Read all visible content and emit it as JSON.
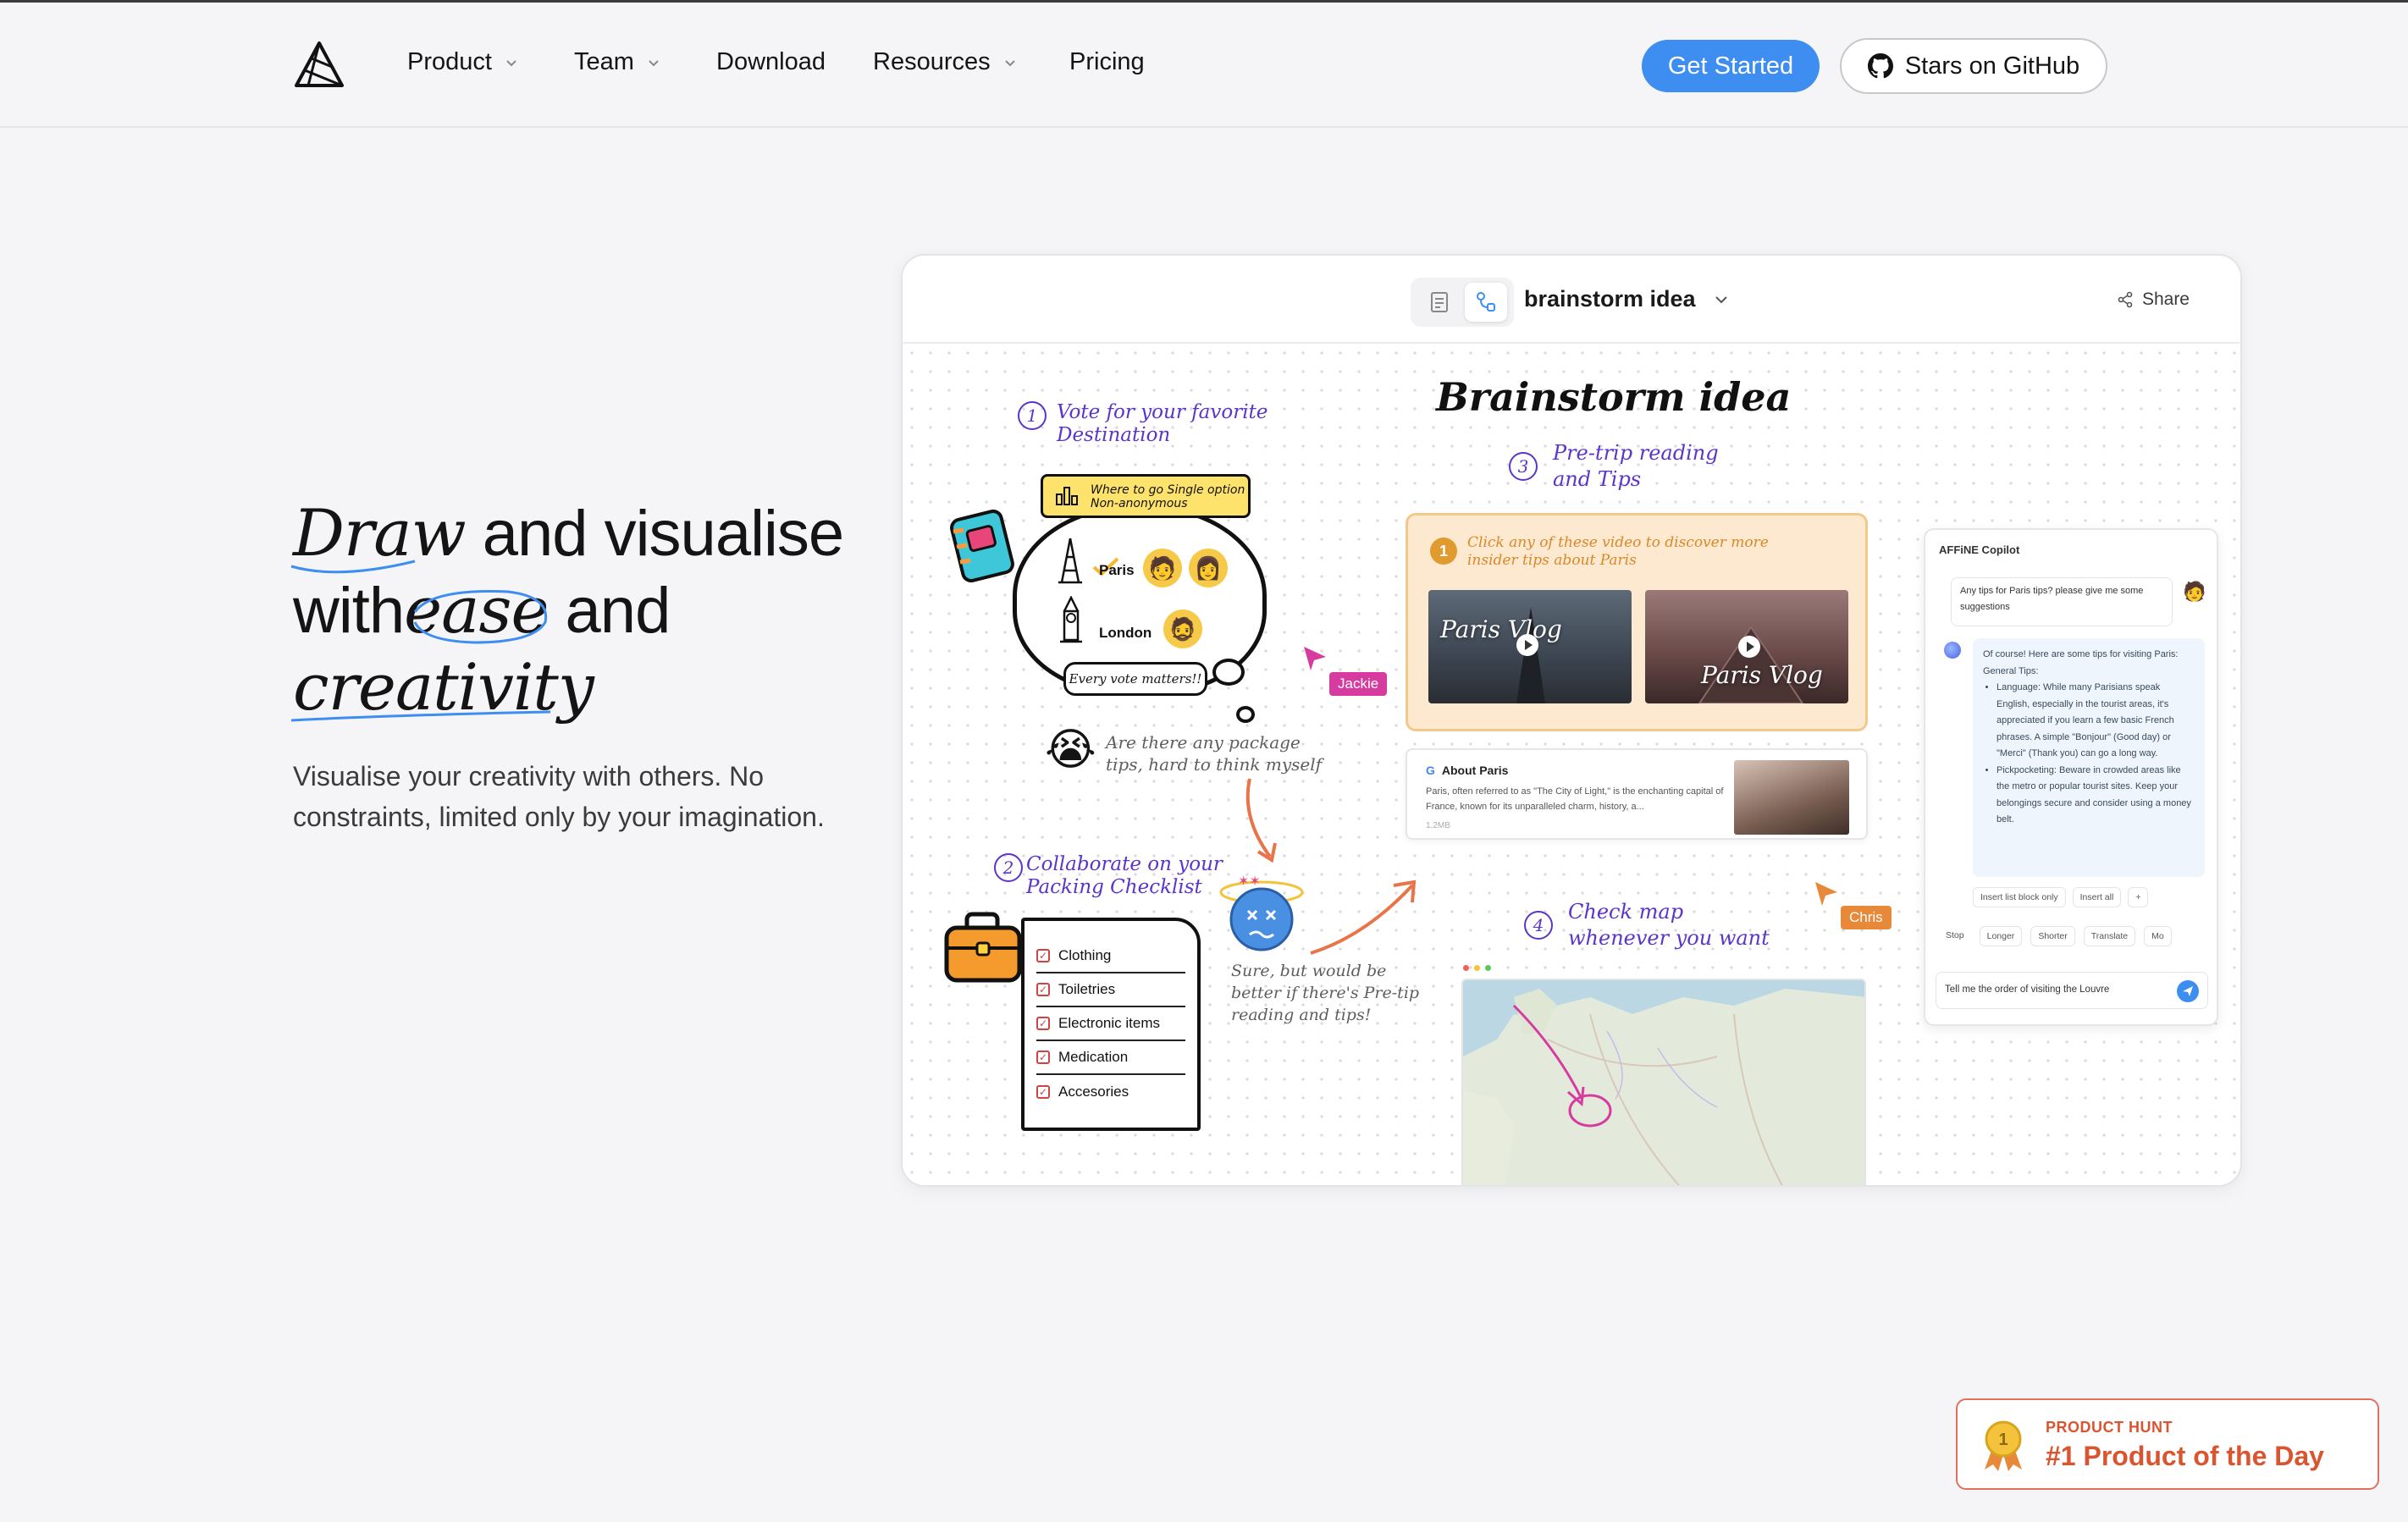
{
  "nav": {
    "items": [
      {
        "label": "Product",
        "dropdown": true
      },
      {
        "label": "Team",
        "dropdown": true
      },
      {
        "label": "Download",
        "dropdown": false
      },
      {
        "label": "Resources",
        "dropdown": true
      },
      {
        "label": "Pricing",
        "dropdown": false
      }
    ],
    "cta_label": "Get Started",
    "github_label": "Stars on GitHub"
  },
  "hero": {
    "title_word1": "Draw",
    "title_part1": " and visualise",
    "title_part2": "with",
    "title_word2": "ease",
    "title_part3": " and",
    "title_word3": "creativity",
    "subtitle": "Visualise your creativity with others. No constraints, limited only by your imagination."
  },
  "app": {
    "doc_title": "brainstorm idea",
    "share_label": "Share",
    "board_title": "Brainstorm idea",
    "step1_num": "1",
    "step1_text": "Vote for your favorite Destination",
    "vote_tag": "Where to go Single option Non-anonymous",
    "option1": "Paris",
    "option2": "London",
    "every_vote": "Every vote matters!!",
    "package_note": "Are there any package tips, hard to think myself",
    "step2_num": "2",
    "step2_text": "Collaborate on your Packing Checklist",
    "checklist": [
      "Clothing",
      "Toiletries",
      "Electronic items",
      "Medication",
      "Accesories"
    ],
    "reply_note": "Sure, but would be better if there's Pre-tip reading and tips!",
    "step3_num": "3",
    "step3_text": "Pre-trip reading and Tips",
    "video_hint_num": "1",
    "video_hint": "Click any of these video to discover more insider tips about Paris",
    "video1_label": "Paris Vlog",
    "video2_label": "Paris Vlog",
    "link_title": "About Paris",
    "link_desc": "Paris, often referred to as \"The City of Light,\" is the enchanting capital of France, known for its unparalleled charm, history, a...",
    "link_meta": "1.2MB",
    "step4_num": "4",
    "step4_text": "Check map whenever you want",
    "cursor1": "Jackie",
    "cursor2": "Chris",
    "copilot": {
      "title": "AFFiNE Copilot",
      "question": "Any tips for Paris tips? please give me some suggestions",
      "answer_intro": "Of course! Here are some tips for visiting Paris:",
      "answer_heading": "General Tips:",
      "answer_b1": "Language: While many Parisians speak English, especially in the tourist areas, it's appreciated if you learn a few basic French phrases. A simple \"Bonjour\" (Good day) or \"Merci\" (Thank you) can go a long way.",
      "answer_b2": "Pickpocketing: Beware in crowded areas like the metro or popular tourist sites. Keep your belongings secure and consider using a money belt.",
      "action1": "Insert list block only",
      "action2": "Insert all",
      "action3": "+",
      "mode_stop": "Stop",
      "mode_longer": "Longer",
      "mode_shorter": "Shorter",
      "mode_translate": "Translate",
      "mode_more": "Mo",
      "input_value": "Tell me the order of visiting the Louvre"
    }
  },
  "badge": {
    "top": "PRODUCT HUNT",
    "main": "#1 Product of the Day",
    "medal": "1"
  },
  "colors": {
    "accent": "#3d8ef0",
    "handwriting": "#5b35c9",
    "product_hunt": "#da552f",
    "jackie": "#d63ba0",
    "chris": "#e8893a"
  }
}
